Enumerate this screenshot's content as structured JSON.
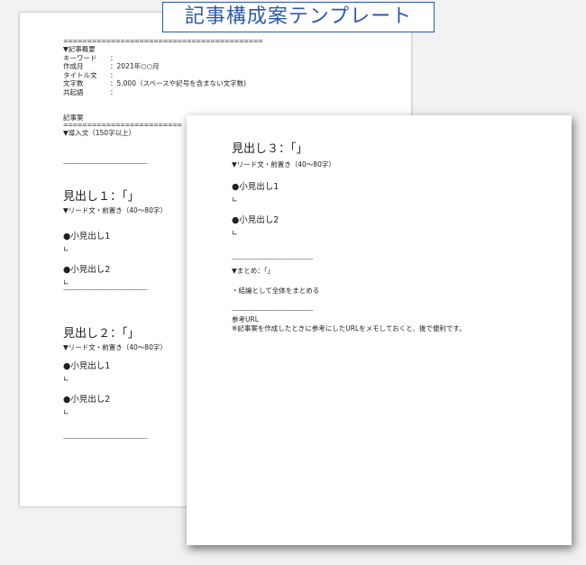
{
  "title": "記事構成案テンプレート",
  "back_page": {
    "rule_top": "==========================================",
    "overview_label": "▼記事概要",
    "fields": [
      {
        "label": "キーワード",
        "value": "："
      },
      {
        "label": "作成月",
        "value": "：2021年○○月"
      },
      {
        "label": "タイトル文",
        "value": "："
      },
      {
        "label": "文字数",
        "value": "：5,000（スペースや記号を含まない文字数)"
      },
      {
        "label": "共起語",
        "value": "："
      }
    ],
    "draft_label": "記事案",
    "rule_draft": "=========================",
    "intro_label": "▼導入文（150字以上）",
    "dash_line": "--------------------------------------------------------",
    "section1": {
      "heading": "見出し１：「」",
      "lead": "▼リード文・前置き（40〜80字）",
      "sub1": "●小見出し1",
      "corner1": "∟",
      "sub2": "●小見出し2",
      "corner2": "∟"
    },
    "section2": {
      "heading": "見出し２：「」",
      "lead": "▼リード文・前置き（40〜80字）",
      "sub1": "●小見出し1",
      "corner1": "∟",
      "sub2": "●小見出し2",
      "corner2": "∟"
    }
  },
  "front_page": {
    "section3": {
      "heading": "見出し３：「」",
      "lead": "▼リード文・前置き（40〜80字）",
      "sub1": "●小見出し1",
      "corner1": "∟",
      "sub2": "●小見出し2",
      "corner2": "∟"
    },
    "dash_line": "------------------------------------------------------",
    "summary_label": "▼まとめ：「」",
    "summary_text": "・結論として全体をまとめる",
    "reference_label": "参考URL",
    "reference_note": "※記事案を作成したときに参考にしたURLをメモしておくと、後で便利です。"
  }
}
